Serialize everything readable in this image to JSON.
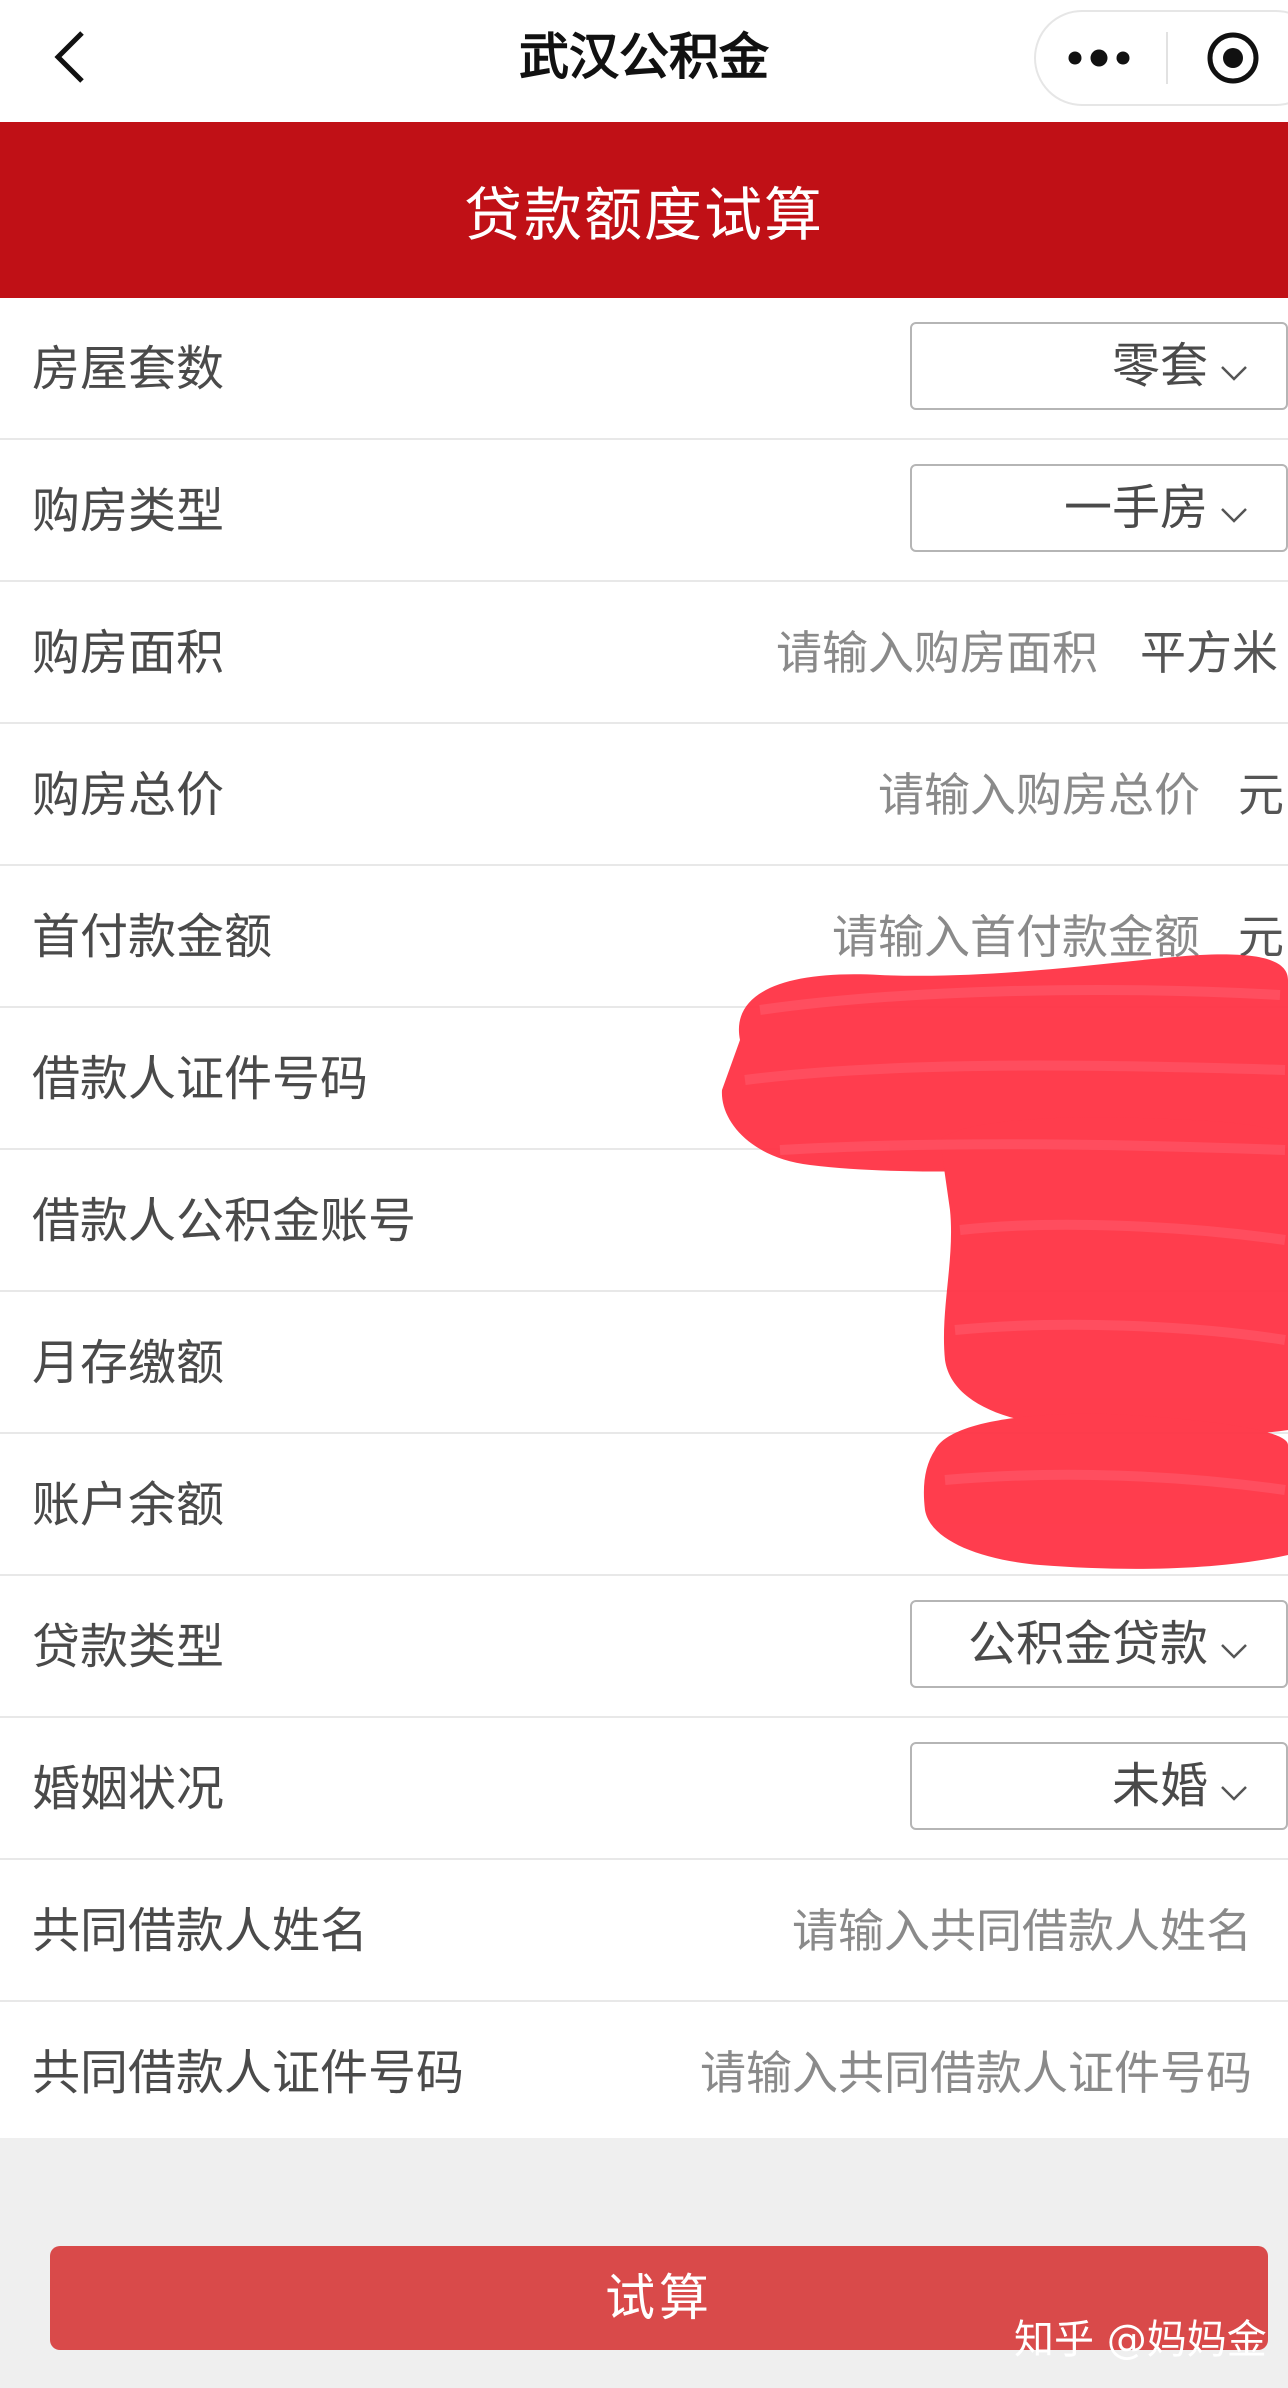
{
  "nav": {
    "title": "武汉公积金",
    "back_icon": "chevron-left-icon",
    "more_icon": "more-dots-icon",
    "close_icon": "record-target-icon"
  },
  "banner": {
    "title": "贷款额度试算"
  },
  "form": {
    "house_count": {
      "label": "房屋套数",
      "value": "零套"
    },
    "purchase_type": {
      "label": "购房类型",
      "value": "一手房"
    },
    "area": {
      "label": "购房面积",
      "placeholder": "请输入购房面积",
      "unit": "平方米"
    },
    "total_price": {
      "label": "购房总价",
      "placeholder": "请输入购房总价",
      "unit": "元"
    },
    "down_payment": {
      "label": "首付款金额",
      "placeholder": "请输入首付款金额",
      "unit": "元"
    },
    "borrower_id": {
      "label": "借款人证件号码"
    },
    "borrower_account": {
      "label": "借款人公积金账号"
    },
    "monthly_deposit": {
      "label": "月存缴额"
    },
    "balance": {
      "label": "账户余额"
    },
    "loan_type": {
      "label": "贷款类型",
      "value": "公积金贷款"
    },
    "marital_status": {
      "label": "婚姻状况",
      "value": "未婚"
    },
    "co_borrower_name": {
      "label": "共同借款人姓名",
      "placeholder": "请输入共同借款人姓名"
    },
    "co_borrower_id": {
      "label": "共同借款人证件号码",
      "placeholder": "请输入共同借款人证件号码"
    }
  },
  "calculate_button": {
    "label": "试算"
  },
  "watermark": {
    "text": "知乎 @妈妈金"
  },
  "colors": {
    "banner_red": "#c01016",
    "button_red": "#d94a4a",
    "scribble_red": "#ff3344"
  }
}
